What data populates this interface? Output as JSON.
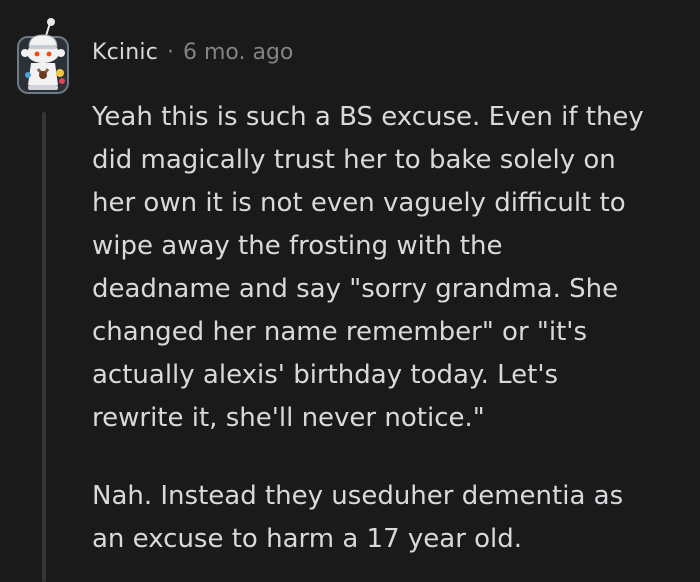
{
  "comment": {
    "author": "Kcinic",
    "separator": "·",
    "timestamp": "6 mo. ago",
    "paragraphs": [
      "Yeah this is such a BS excuse. Even if they\ndid magically trust her to bake solely on\nher own it is not even vaguely difficult to\nwipe away the frosting with the\ndeadname and say \"sorry grandma. She\nchanged her name remember\" or \"it's\nactually alexis' birthday today. Let's\nrewrite it, she'll never notice.\"",
      "Nah. Instead they useduher dementia as\nan excuse to harm a 17 year old."
    ]
  },
  "colors": {
    "background": "#1a1a1b",
    "text": "#d7dadc",
    "muted": "#818384",
    "thread_line": "#343536"
  },
  "icons": {
    "avatar": "snoo-avatar-icon"
  }
}
